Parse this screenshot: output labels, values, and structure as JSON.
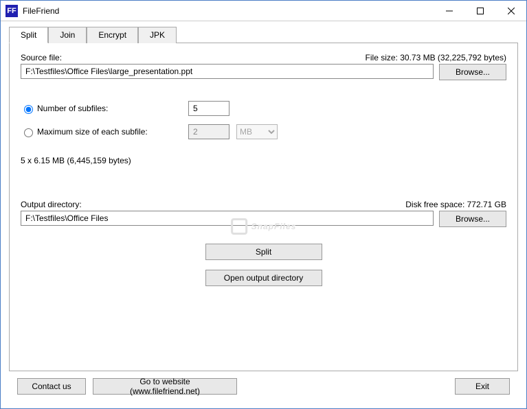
{
  "window": {
    "title": "FileFriend",
    "icon_text": "FF"
  },
  "tabs": {
    "split": "Split",
    "join": "Join",
    "encrypt": "Encrypt",
    "jpk": "JPK"
  },
  "split_panel": {
    "source_label": "Source file:",
    "file_size_label": "File size: 30.73 MB (32,225,792 bytes)",
    "source_value": "F:\\Testfiles\\Office Files\\large_presentation.ppt",
    "browse_label": "Browse...",
    "radio_number_label": "Number of subfiles:",
    "number_value": "5",
    "radio_maxsize_label": "Maximum size of each subfile:",
    "maxsize_value": "2",
    "maxsize_unit": "MB",
    "result_text": "5 x 6.15 MB (6,445,159 bytes)",
    "output_label": "Output directory:",
    "disk_space_label": "Disk free space: 772.71 GB",
    "output_value": "F:\\Testfiles\\Office Files",
    "split_button": "Split",
    "open_output_button": "Open output directory"
  },
  "watermark": "SnapFiles",
  "bottom": {
    "contact": "Contact us",
    "website": "Go to website (www.filefriend.net)",
    "exit": "Exit"
  }
}
